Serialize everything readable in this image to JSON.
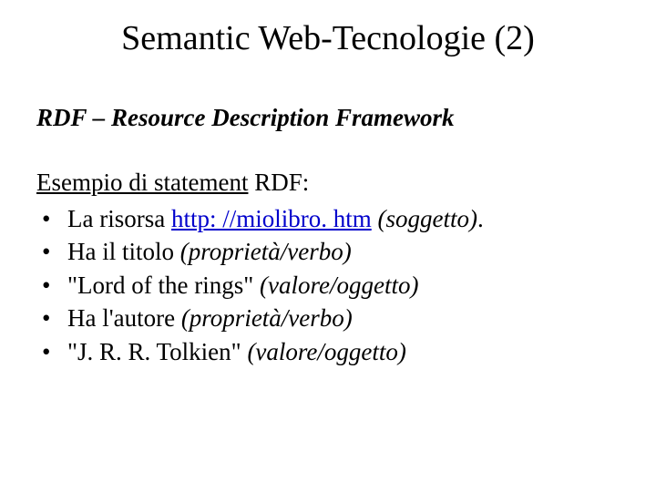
{
  "title": "Semantic Web-Tecnologie (2)",
  "section": "RDF – Resource Description Framework",
  "lead_underlined": "Esempio di statement",
  "lead_rest": " RDF:",
  "bullets": [
    {
      "pre": "La risorsa ",
      "link": "http: //miolibro. htm",
      "post": "  ",
      "paren": "(soggetto)",
      "tail": "."
    },
    {
      "pre": "Ha il titolo ",
      "link": "",
      "post": "",
      "paren": "(proprietà/verbo)",
      "tail": ""
    },
    {
      "pre": "\"Lord of the rings\" ",
      "link": "",
      "post": "",
      "paren": "(valore/oggetto)",
      "tail": ""
    },
    {
      "pre": "Ha l'autore ",
      "link": "",
      "post": "",
      "paren": "(proprietà/verbo)",
      "tail": ""
    },
    {
      "pre": "\"J. R. R. Tolkien\" ",
      "link": "",
      "post": "",
      "paren": "(valore/oggetto)",
      "tail": ""
    }
  ]
}
